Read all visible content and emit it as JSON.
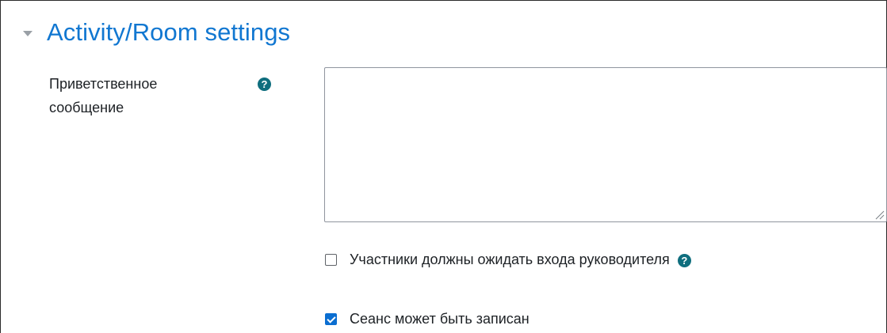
{
  "section": {
    "title": "Activity/Room settings",
    "toggle_icon": "caret-down-icon"
  },
  "welcome": {
    "label_line1": "Приветственное",
    "label_line2": "сообщение",
    "help_icon": "question-circle-icon",
    "help_glyph": "?",
    "value": ""
  },
  "checkboxes": [
    {
      "label": "Участники должны ожидать входа руководителя",
      "checked": false,
      "has_help": true,
      "help_glyph": "?"
    },
    {
      "label": "Сеанс может быть записан",
      "checked": true,
      "has_help": false
    }
  ],
  "colors": {
    "title": "#1177d1",
    "help_icon": "#0f6e7e",
    "checkbox_checked": "#0b6ed1"
  }
}
